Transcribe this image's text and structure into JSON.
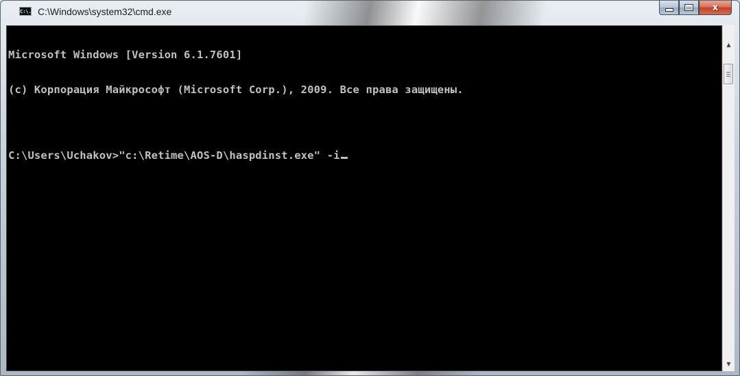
{
  "window": {
    "title": "C:\\Windows\\system32\\cmd.exe",
    "icon_text": "C:\\."
  },
  "controls": {
    "minimize": "minimize-icon",
    "maximize": "maximize-icon",
    "close_glyph": "x"
  },
  "console": {
    "lines": [
      "Microsoft Windows [Version 6.1.7601]",
      "(c) Корпорация Майкрософт (Microsoft Corp.), 2009. Все права защищены.",
      "",
      "C:\\Users\\Uchakov>\"c:\\Retime\\AOS-D\\haspdinst.exe\" -i"
    ]
  },
  "scrollbar": {
    "up_arrow": "▲",
    "down_arrow": "▼"
  },
  "colors": {
    "console_bg": "#000000",
    "console_text": "#c0c0c0",
    "close_button": "#c2412a"
  }
}
